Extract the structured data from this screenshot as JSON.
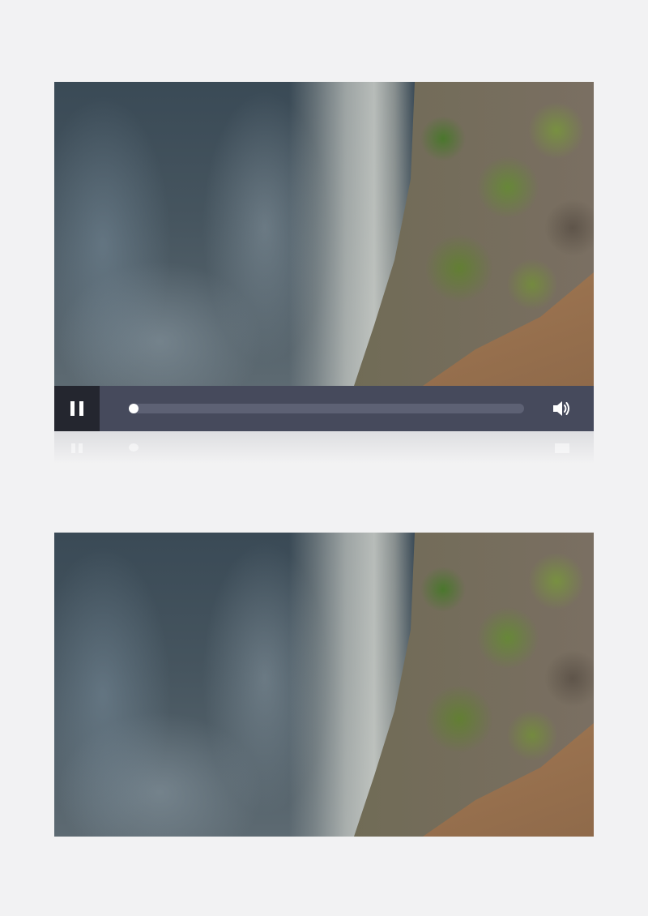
{
  "players": [
    {
      "scene": "waterfall-rock-frame",
      "state": "playing",
      "progress_fraction": 0.0,
      "controls": {
        "play_button_icon": "pause-icon",
        "volume_button_icon": "speaker-volume-icon"
      }
    },
    {
      "scene": "waterfall-rock-frame",
      "controls_visible": false
    }
  ],
  "colors": {
    "page_background": "#f2f2f3",
    "control_bar": "#464a5c",
    "play_button_bg": "#24262f",
    "progress_track": "#5d6174",
    "icon": "#ffffff"
  }
}
